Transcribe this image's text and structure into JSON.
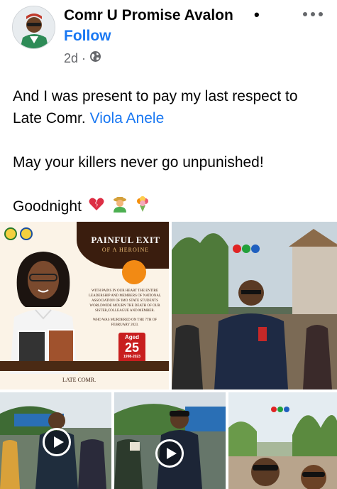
{
  "post": {
    "author": "Comr U Promise Avalon",
    "separator": "•",
    "follow_label": "Follow",
    "timestamp": "2d",
    "meta_dot": "·",
    "privacy_icon": "globe-icon",
    "more_icon": "more-options-icon"
  },
  "body": {
    "line1": "And I was present to pay my last respect to Late Comr.",
    "mention": "Viola Anele",
    "line2": "May your killers never go unpunished!",
    "line3": "Goodnight",
    "emojis": [
      "broken-heart-emoji",
      "man-farmer-emoji",
      "bouquet-emoji"
    ]
  },
  "poster": {
    "title": "PAINFUL EXIT",
    "subtitle": "OF A HEROINE",
    "text": "WITH PAINS IN OUR HEART THE ENTIRE LEADERSHIP AND MEMBERS OF NATIONAL ASSOCIATION OF IMO STATE STUDENTS WORLDWIDE MOURN THE DEATH OF OUR SISTER,COLLEAGUE AND MEMBER.",
    "text2": "WHO WAS MURDERED ON THE 7TH OF FEBRUARY 2023.",
    "aged_label": "Aged",
    "aged_value": "25",
    "aged_years": "1998-2023",
    "late_label": "LATE COMR."
  },
  "videos": [
    {
      "name": "video-tile-1",
      "play_icon": "play-icon"
    },
    {
      "name": "video-tile-2",
      "play_icon": "play-icon"
    }
  ],
  "colors": {
    "brand_blue": "#1877f2",
    "text_primary": "#050505",
    "text_secondary": "#65676b",
    "poster_brown": "#3a1d0e",
    "poster_orange": "#f28a14",
    "poster_red": "#c81e1e"
  }
}
